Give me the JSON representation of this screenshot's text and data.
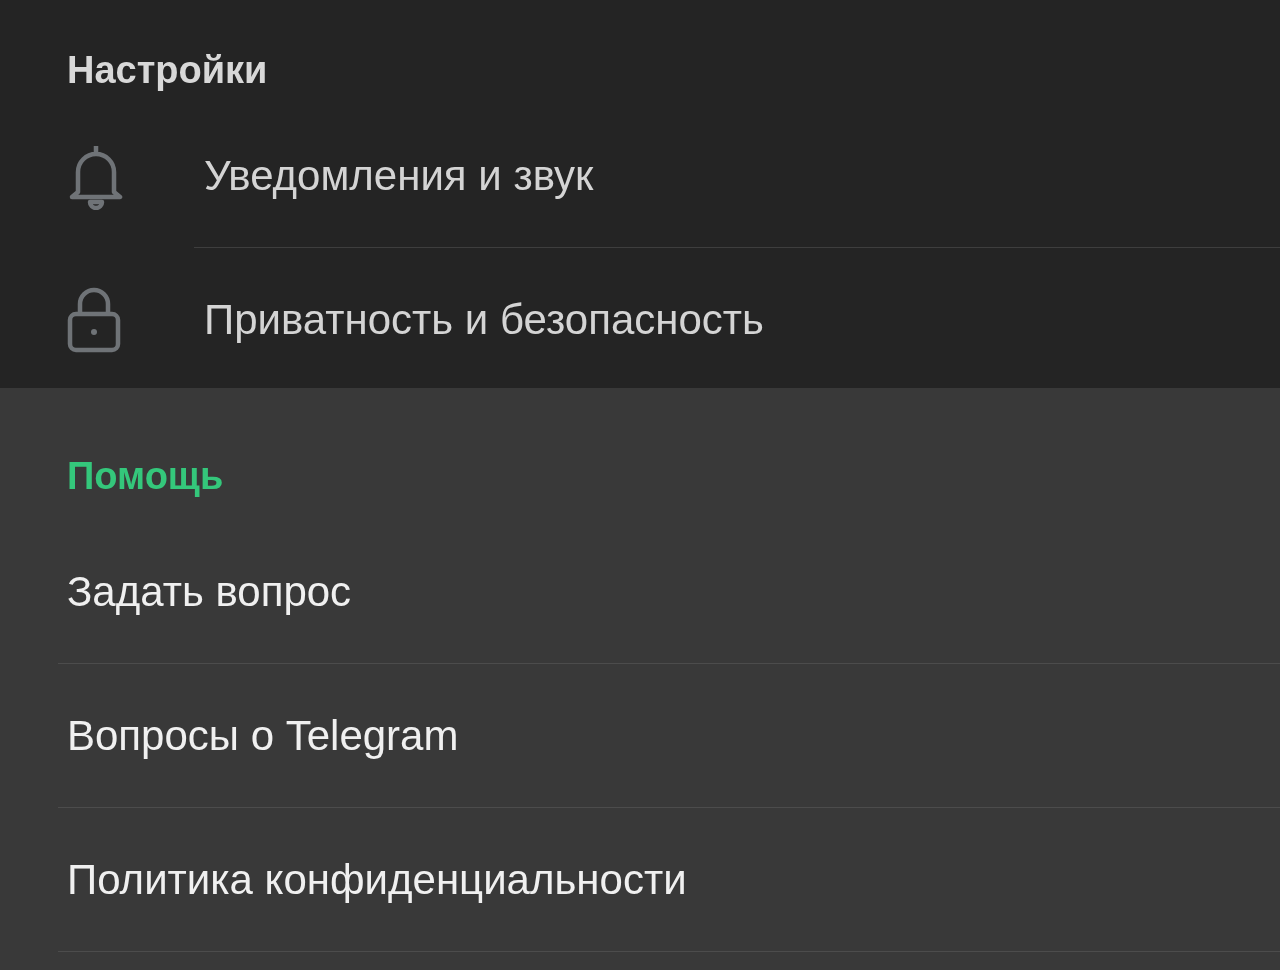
{
  "settings": {
    "title": "Настройки",
    "items": [
      {
        "label": "Уведомления и звук"
      },
      {
        "label": "Приватность и безопасность"
      }
    ]
  },
  "help": {
    "title": "Помощь",
    "items": [
      {
        "label": "Задать вопрос"
      },
      {
        "label": "Вопросы о Telegram"
      },
      {
        "label": "Политика конфиденциальности"
      }
    ]
  }
}
